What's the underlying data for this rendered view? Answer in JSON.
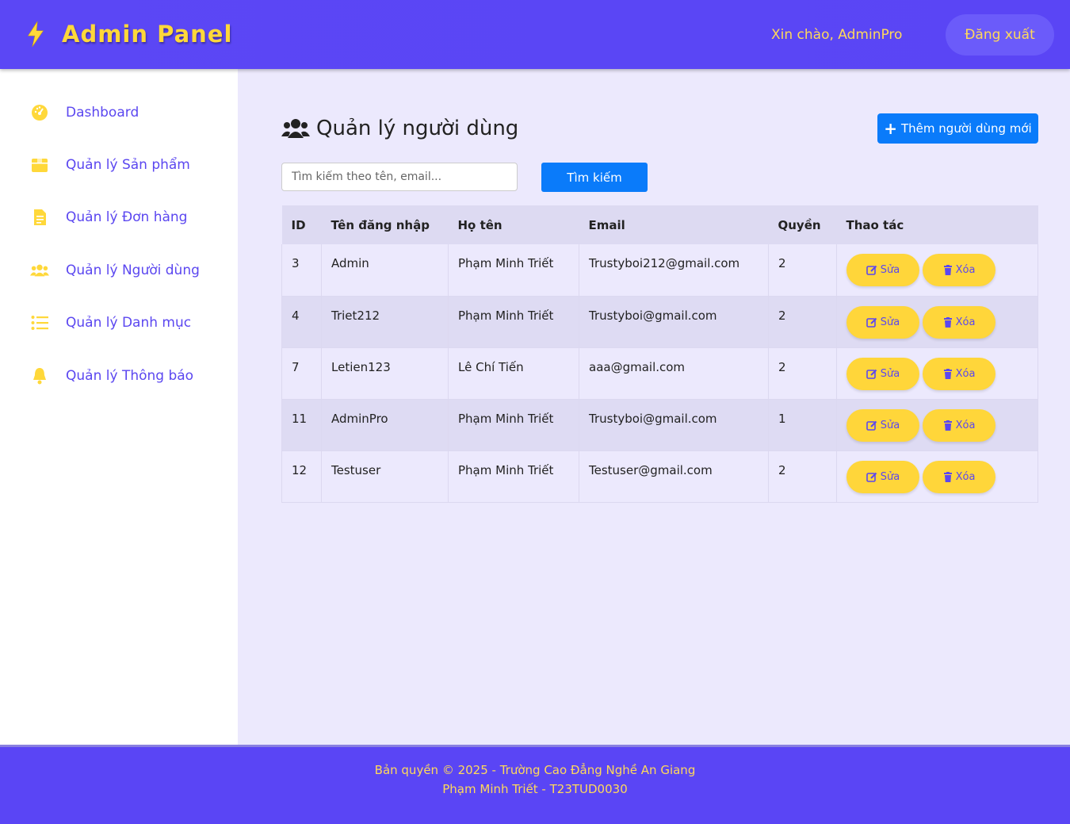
{
  "header": {
    "brand": "Admin Panel",
    "greeting": "Xin chào, AdminPro",
    "logout_label": "Đăng xuất"
  },
  "sidebar": {
    "items": [
      {
        "label": "Dashboard",
        "icon": "dashboard-icon"
      },
      {
        "label": "Quản lý Sản phẩm",
        "icon": "box-icon"
      },
      {
        "label": "Quản lý Đơn hàng",
        "icon": "file-icon"
      },
      {
        "label": "Quản lý Người dùng",
        "icon": "users-icon"
      },
      {
        "label": "Quản lý Danh mục",
        "icon": "list-icon"
      },
      {
        "label": "Quản lý Thông báo",
        "icon": "bell-icon"
      }
    ]
  },
  "main": {
    "title": "Quản lý người dùng",
    "add_button": "Thêm người dùng mới",
    "search": {
      "placeholder": "Tìm kiếm theo tên, email...",
      "button": "Tìm kiếm"
    },
    "table": {
      "headers": [
        "ID",
        "Tên đăng nhập",
        "Họ tên",
        "Email",
        "Quyền",
        "Thao tác"
      ],
      "rows": [
        [
          "3",
          "Admin",
          "Phạm Minh Triết",
          "Trustyboi212@gmail.com",
          "2"
        ],
        [
          "4",
          "Triet212",
          "Phạm Minh Triết",
          "Trustyboi@gmail.com",
          "2"
        ],
        [
          "7",
          "Letien123",
          "Lê Chí Tiến",
          "aaa@gmail.com",
          "2"
        ],
        [
          "11",
          "AdminPro",
          "Phạm Minh Triết",
          "Trustyboi@gmail.com",
          "1"
        ],
        [
          "12",
          "Testuser",
          "Phạm Minh Triết",
          "Testuser@gmail.com",
          "2"
        ]
      ],
      "edit_label": "Sửa",
      "delete_label": "Xóa"
    }
  },
  "footer": {
    "line1": "Bản quyền © 2025 - Trường Cao Đẳng Nghề An Giang",
    "line2": "Phạm Minh Triết - T23TUD0030"
  },
  "colors": {
    "primary": "#5b47f5",
    "accent": "#ffd83a",
    "button_blue": "#0a7bfa",
    "background": "#ece9fd"
  }
}
